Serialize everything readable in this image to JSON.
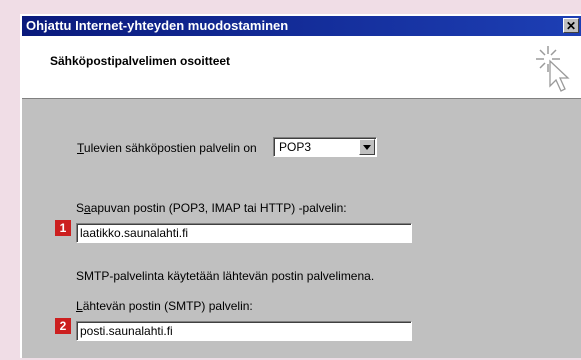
{
  "window": {
    "title": "Ohjattu Internet-yhteyden muodostaminen",
    "close_label": "✕"
  },
  "header": {
    "title": "Sähköpostipalvelimen osoitteet"
  },
  "form": {
    "incoming_type": {
      "label_underlined": "T",
      "label_rest": "ulevien sähköpostien palvelin on",
      "selected": "POP3"
    },
    "incoming_server": {
      "label_prefix": "S",
      "label_underlined": "a",
      "label_rest": "apuvan postin (POP3, IMAP tai HTTP) -palvelin:",
      "value": "laatikko.saunalahti.fi",
      "badge": "1"
    },
    "smtp_info": "SMTP-palvelinta käytetään lähtevän postin palvelimena.",
    "outgoing_server": {
      "label_underlined": "L",
      "label_rest": "ähtevän postin (SMTP) palvelin:",
      "value": "posti.saunalahti.fi",
      "badge": "2"
    }
  },
  "colors": {
    "titlebar": "#0a1a7c",
    "badge": "#cc1f1f",
    "background": "#f0dde6"
  }
}
